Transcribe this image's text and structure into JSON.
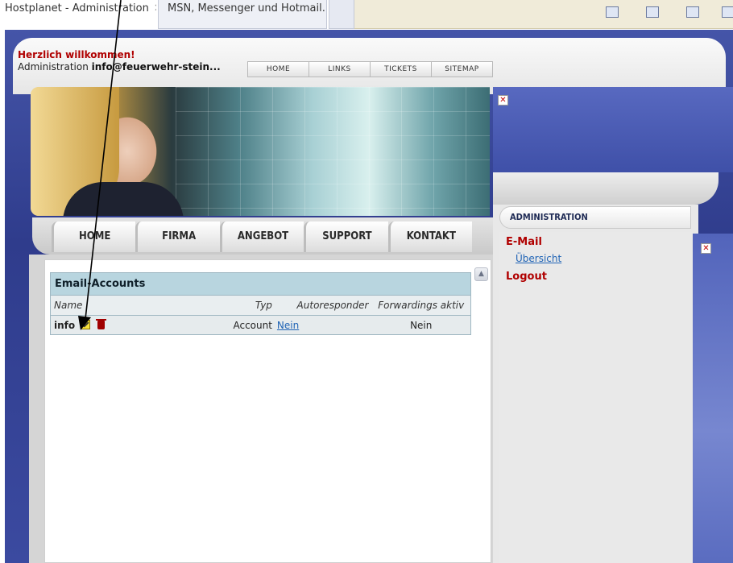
{
  "browser": {
    "tabs": [
      {
        "title": "Hostplanet - Administration",
        "active": true
      },
      {
        "title": "MSN, Messenger und Hotmail...",
        "active": false
      }
    ]
  },
  "header": {
    "welcome": "Herzlich willkommen!",
    "admin_prefix": "Administration",
    "admin_account": "info@feuerwehr-stein...",
    "topnav": [
      "HOME",
      "LINKS",
      "TICKETS",
      "SITEMAP"
    ]
  },
  "mainnav": [
    "HOME",
    "FIRMA",
    "ANGEBOT",
    "SUPPORT",
    "KONTAKT"
  ],
  "accounts_table": {
    "title": "Email-Accounts",
    "columns": [
      "Name",
      "Typ",
      "Autoresponder",
      "Forwardings aktiv"
    ],
    "rows": [
      {
        "name": "info",
        "typ": "Account",
        "autoresponder": "Nein",
        "forwardings": "Nein"
      }
    ]
  },
  "sidebar": {
    "heading": "ADMINISTRATION",
    "section": "E-Mail",
    "link": "Übersicht",
    "logout": "Logout"
  },
  "icons": {
    "close": "x-icon",
    "edit": "edit-icon",
    "delete": "trash-icon"
  }
}
